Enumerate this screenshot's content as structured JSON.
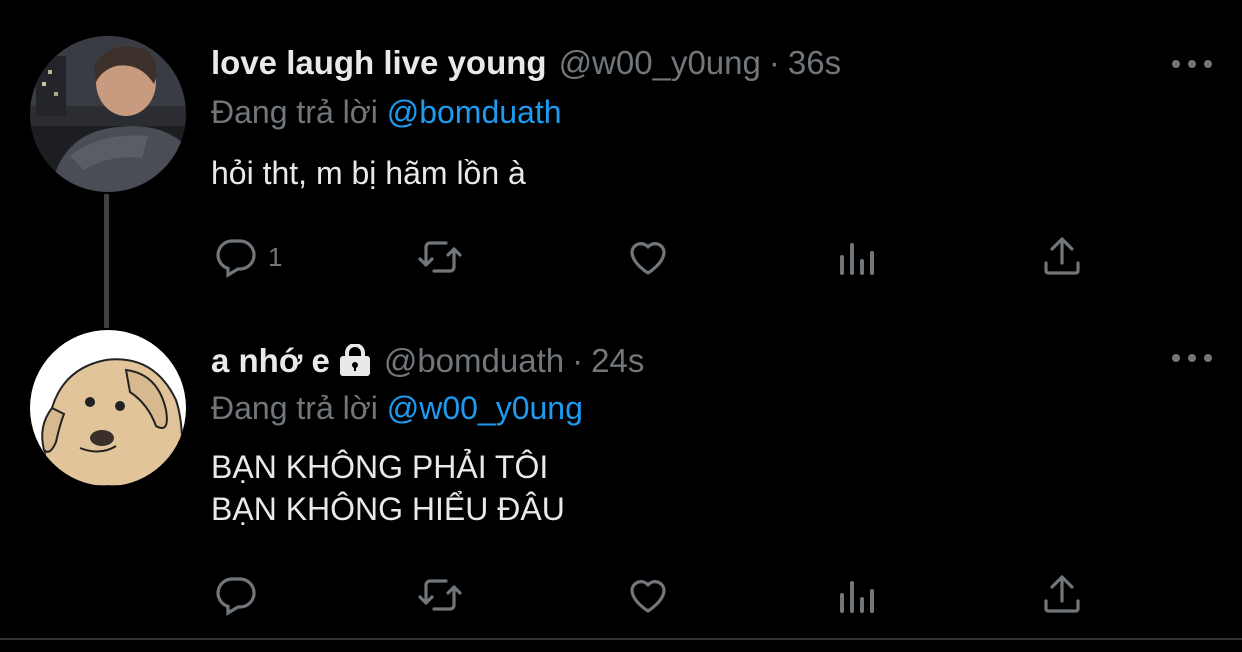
{
  "colors": {
    "background": "#000000",
    "text": "#e7e9ea",
    "muted": "#71767b",
    "mention": "#1d9bf0"
  },
  "tweets": [
    {
      "name": "love laugh live young",
      "handle": "@w00_y0ung",
      "separator": "·",
      "time": "36s",
      "reply_prefix": "Đang trả lời",
      "reply_mention": "@bomduath",
      "lines": [
        "hỏi tht, m bị hãm lồn à"
      ],
      "reply_count": "1",
      "protected": false,
      "icons": [
        "reply-icon",
        "retweet-icon",
        "like-icon",
        "views-icon",
        "share-icon",
        "more-icon"
      ]
    },
    {
      "name": "a nhớ e",
      "handle": "@bomduath",
      "separator": "·",
      "time": "24s",
      "reply_prefix": "Đang trả lời",
      "reply_mention": "@w00_y0ung",
      "lines": [
        "BẠN KHÔNG PHẢI TÔI",
        "BẠN KHÔNG HIỂU ĐÂU"
      ],
      "reply_count": "",
      "protected": true,
      "icons": [
        "reply-icon",
        "retweet-icon",
        "like-icon",
        "views-icon",
        "share-icon",
        "more-icon",
        "lock-icon"
      ]
    }
  ]
}
